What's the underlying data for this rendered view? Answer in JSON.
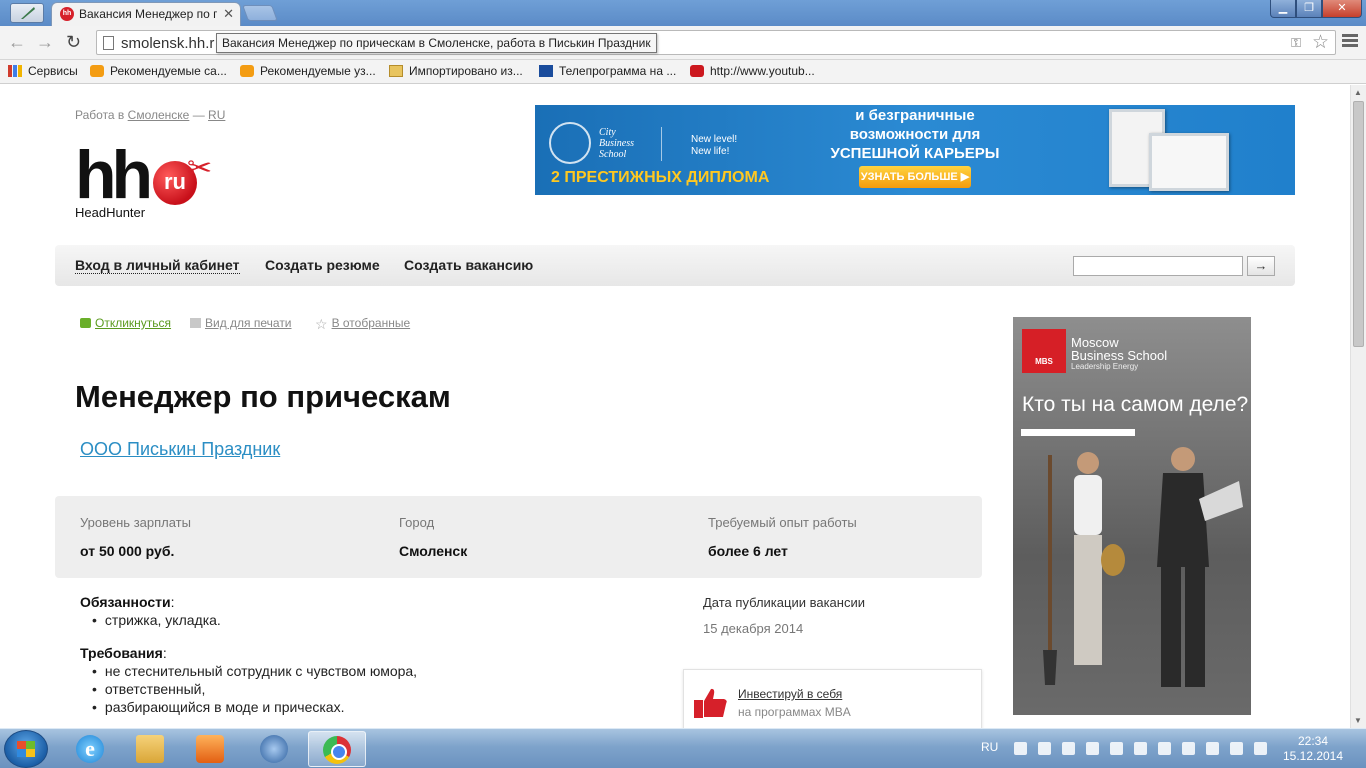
{
  "browser": {
    "tab_title": "Вакансия Менеджер по п",
    "tab_favicon": "hh",
    "url": "smolensk.hh.r",
    "tooltip": "Вакансия Менеджер по прическам в Смоленске, работа в Писькин Праздник",
    "bookmarks": [
      {
        "label": "Сервисы",
        "icon": "apps-icon"
      },
      {
        "label": "Рекомендуемые са...",
        "icon": "orange-icon"
      },
      {
        "label": "Рекомендуемые уз...",
        "icon": "orange-icon"
      },
      {
        "label": "Импортировано из...",
        "icon": "folder-icon"
      },
      {
        "label": "Телепрограмма на ...",
        "icon": "tv-icon"
      },
      {
        "label": "http://www.youtub...",
        "icon": "youtube-icon"
      }
    ]
  },
  "page": {
    "region": {
      "prefix": "Работа в",
      "city": "Смоленске",
      "sep": "—",
      "lang": "RU"
    },
    "logo": {
      "text": "hh",
      "badge": "ru",
      "sub": "HeadHunter"
    },
    "banner": {
      "school": [
        "City",
        "Business",
        "School"
      ],
      "tagline": [
        "New level!",
        "New life!"
      ],
      "diplomas": "2 ПРЕСТИЖНЫХ ДИПЛОМА",
      "headline": [
        "и безграничные",
        "возможности для",
        "УСПЕШНОЙ КАРЬЕРЫ"
      ],
      "cta": "УЗНАТЬ БОЛЬШЕ"
    },
    "menu": {
      "login": "Вход в личный кабинет",
      "create_resume": "Создать резюме",
      "create_vacancy": "Создать вакансию",
      "search_go": "→"
    },
    "actions": {
      "respond": "Откликнуться",
      "print": "Вид для печати",
      "favorite": "В отобранные"
    },
    "vacancy": {
      "title": "Менеджер по прическам",
      "company": "ООО Писькин Праздник",
      "salary_label": "Уровень зарплаты",
      "salary": "от 50 000 руб.",
      "city_label": "Город",
      "city": "Смоленск",
      "experience_label": "Требуемый опыт работы",
      "experience": "более 6 лет",
      "duties_head": "Обязанности",
      "duties": [
        "стрижка, укладка."
      ],
      "req_head": "Требования",
      "requirements": [
        "не стеснительный сотрудник с чувством юмора,",
        "ответственный,",
        "разбирающийся в моде и прическах."
      ],
      "pub_label": "Дата публикации вакансии",
      "pub_date": "15 декабря 2014"
    },
    "mba": {
      "title": "Инвестируй в себя",
      "subtitle": "на программах MBA"
    },
    "mbs_ad": {
      "logo": "MBS",
      "name": [
        "Moscow",
        "Business School"
      ],
      "tag": "Leadership Energy",
      "question": "Кто ты на самом деле?"
    }
  },
  "taskbar": {
    "lang": "RU",
    "time": "22:34",
    "date": "15.12.2014",
    "apps": [
      "ie-icon",
      "explorer-icon",
      "media-player-icon",
      "thunderbird-icon",
      "chrome-icon"
    ]
  }
}
